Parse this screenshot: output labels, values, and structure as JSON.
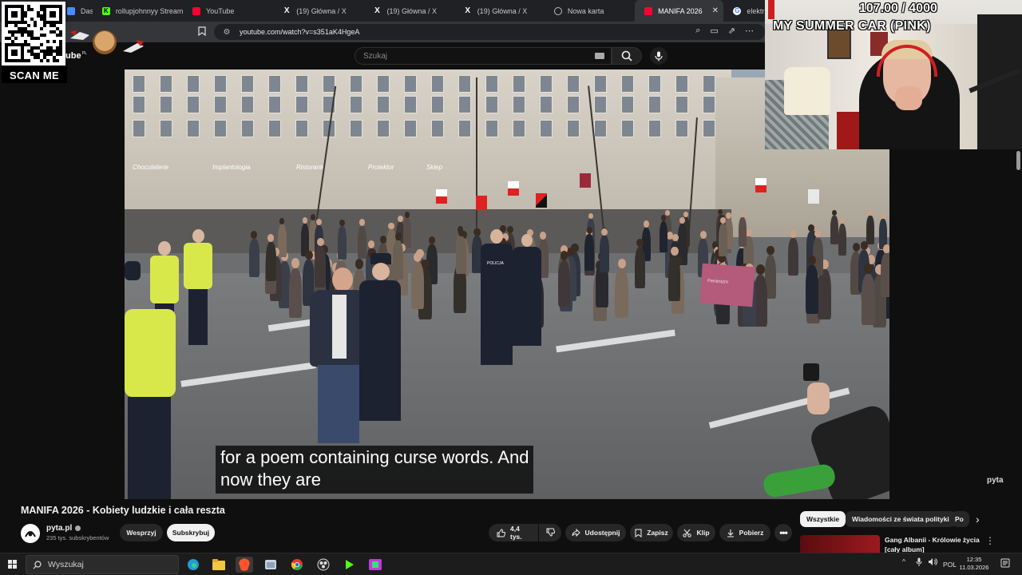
{
  "browser": {
    "tabs": [
      {
        "label": "Dash",
        "favicon": "dashboard-icon",
        "color": "#4a8cff"
      },
      {
        "label": "rollupjohnnyy Stream",
        "favicon": "kick-icon",
        "color": "#53fc18"
      },
      {
        "label": "YouTube",
        "favicon": "youtube-icon",
        "color": "#ff0033"
      },
      {
        "label": "(19) Główna / X",
        "favicon": "x-icon",
        "color": "#ffffff"
      },
      {
        "label": "(19) Główna / X",
        "favicon": "x-icon",
        "color": "#ffffff"
      },
      {
        "label": "(19) Główna / X",
        "favicon": "x-icon",
        "color": "#ffffff"
      },
      {
        "label": "Nowa karta",
        "favicon": "brave-shield-icon",
        "color": "#bbbbbb"
      },
      {
        "label": "MANIFA 2026",
        "favicon": "youtube-icon",
        "color": "#ff0033",
        "active": true
      },
      {
        "label": "elektr",
        "favicon": "google-icon",
        "color": "#4285f4"
      }
    ],
    "url": "youtube.com/watch?v=s351aK4HgeA"
  },
  "youtube": {
    "logo_fragment": "ube",
    "logo_region": "PL",
    "search_placeholder": "Szukaj"
  },
  "overlay": {
    "qr_caption": "SCAN ME",
    "game_title": "MY SUMMER CAR (PINK)",
    "counter": "107.00 / 4000"
  },
  "video": {
    "subtitle_lines": [
      "for a poem containing curse words.  And",
      "now they are"
    ],
    "shop_signs": [
      "Chocolaterie",
      "Implantologia",
      "Ristorante",
      "Protektor",
      "Sklep"
    ],
    "banner_text": "Feminizm",
    "police_label": "POLICJA",
    "watermark": "pyta"
  },
  "watch": {
    "title": "MANIFA 2026 - Kobiety ludzkie i cała reszta",
    "channel_name": "pyta.pl",
    "channel_subs": "235 tys. subskrybentów",
    "support_label": "Wesprzyj",
    "subscribe_label": "Subskrybuj",
    "like_count": "4,4 tys.",
    "share_label": "Udostępnij",
    "save_label": "Zapisz",
    "clip_label": "Klip",
    "download_label": "Pobierz"
  },
  "sidebar": {
    "chips": [
      "Wszystkie",
      "Wiadomości ze świata polityki",
      "Po"
    ],
    "next_video_title_line1": "Gang Albanii - Królowie życia",
    "next_video_title_line2": "[cały album]"
  },
  "taskbar": {
    "search_label": "Wyszukaj",
    "language": "POL",
    "time": "12:35",
    "date": "11.03.2026"
  }
}
